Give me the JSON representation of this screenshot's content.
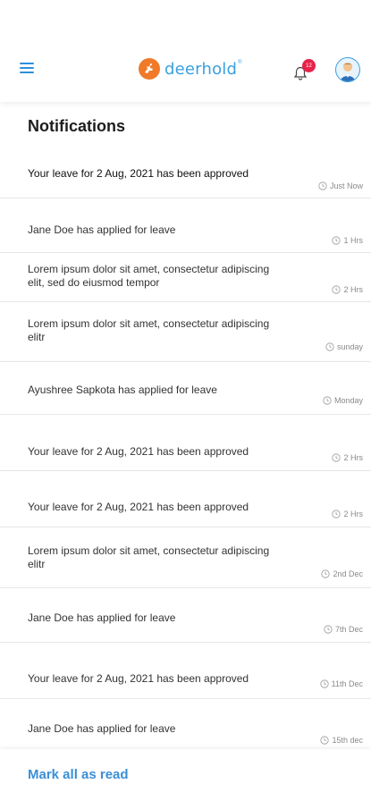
{
  "header": {
    "brand": "deerhold",
    "brand_reg": "®",
    "notification_count": "12",
    "colors": {
      "brand": "#3aa0e0",
      "logo_mark": "#f07a2a",
      "badge": "#e8234a"
    }
  },
  "page": {
    "title": "Notifications"
  },
  "notifications": [
    {
      "message": "Your leave for 2 Aug, 2021 has been approved",
      "time": "Just Now"
    },
    {
      "message": "Jane Doe has applied for leave",
      "time": "1 Hrs"
    },
    {
      "message": "Lorem ipsum dolor sit amet, consectetur adipiscing elit, sed do eiusmod tempor",
      "time": "2 Hrs"
    },
    {
      "message": "Lorem ipsum dolor sit amet, consectetur adipiscing elitr",
      "time": "sunday"
    },
    {
      "message": "Ayushree Sapkota has applied for leave",
      "time": "Monday"
    },
    {
      "message": "Your leave for 2 Aug, 2021 has been approved",
      "time": "2 Hrs"
    },
    {
      "message": "Your leave for 2 Aug, 2021 has been approved",
      "time": "2 Hrs"
    },
    {
      "message": "Lorem ipsum dolor sit amet, consectetur adipiscing elitr",
      "time": "2nd Dec"
    },
    {
      "message": "Jane Doe has applied for leave",
      "time": "7th Dec"
    },
    {
      "message": "Your leave for 2 Aug, 2021 has been approved",
      "time": "11th Dec"
    },
    {
      "message": "Jane Doe has applied for leave",
      "time": "15th dec"
    }
  ],
  "footer": {
    "mark_all_label": "Mark all as read"
  },
  "icons": {
    "menu": "hamburger-icon",
    "bell": "bell-icon",
    "clock": "clock-icon",
    "avatar": "user-avatar"
  }
}
